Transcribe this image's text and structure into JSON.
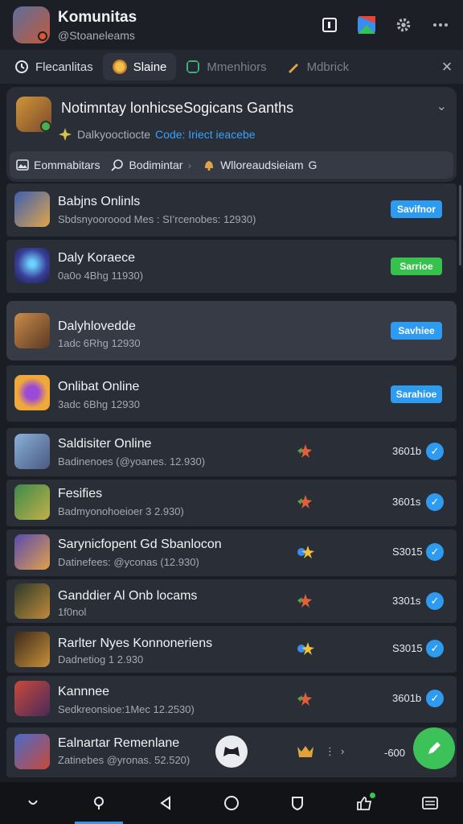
{
  "header": {
    "title": "Komunitas",
    "handle": "@Stoaneleams",
    "icons": [
      "square-icon",
      "color-tile-icon",
      "gear-icon",
      "more-icon"
    ]
  },
  "tabs": [
    {
      "label": "Flecanlitas",
      "icon": "clock-icon",
      "active": false
    },
    {
      "label": "Slaine",
      "icon": "game-icon",
      "active": true
    },
    {
      "label": "Mmenhiors",
      "icon": "chat-icon",
      "active": false
    },
    {
      "label": "Mdbrick",
      "icon": "pen-icon",
      "active": false
    }
  ],
  "notification": {
    "title": "Notimntay lonhicseSogicans Ganths",
    "sub_prefix": "Dalkyooctiocte",
    "sub_link": "Code: Iriect ieacebe",
    "filters": [
      {
        "label": "Eommabitars",
        "icon": "image-icon"
      },
      {
        "label": "Bodimintar",
        "icon": "search-icon"
      },
      {
        "label": "Wlloreaudsieiam",
        "icon": "bell-icon"
      }
    ],
    "filters_extra": "G"
  },
  "games": [
    {
      "title": "Babjns Onlinls",
      "subtitle": "Sbdsnyooroood Mes : SI’rcenobes: 12930)",
      "action": "Savifnor",
      "action_color": "blue"
    },
    {
      "title": "Daly Koraece",
      "subtitle": "0a0o 4Bhg 11930)",
      "action": "Sarrioe",
      "action_color": "green"
    },
    {
      "title": "Dalyhlovedde",
      "subtitle": "1adc 6Rhg 12930",
      "action": "Savhiee",
      "action_color": "blue"
    },
    {
      "title": "Onlibat Online",
      "subtitle": "3adc 6Bhg 12930",
      "action": "Sarahioe",
      "action_color": "blue"
    }
  ],
  "list": [
    {
      "title": "Saldisiter Online",
      "subtitle": "Badinenoes (@yoanes. 12.930)",
      "count": "3601b",
      "badge": "leaf-icon"
    },
    {
      "title": "Fesifies",
      "subtitle": "Badmyonohoeioer 3 2.930)",
      "count": "3601s",
      "badge": "leaf-icon"
    },
    {
      "title": "Sarynicfopent Gd Sbanlocon",
      "subtitle": "Datinefees: @yconas (12.930)",
      "count": "S3015",
      "badge": "gem-icon"
    },
    {
      "title": "Ganddier Al Onb locams",
      "subtitle": "1f0nol",
      "count": "3301s",
      "badge": "leaf-icon"
    },
    {
      "title": "Rarlter Nyes Konnoneriens",
      "subtitle": "Dadnetiog 1 2.930",
      "count": "S3015",
      "badge": "gem-icon"
    },
    {
      "title": "Kannnee",
      "subtitle": "Sedkreonsioe:1Mec 12.2530)",
      "count": "3601b",
      "badge": "leaf-icon"
    },
    {
      "title": "Ealnartar Remenlane",
      "subtitle": "Zatinebes @yronas. 52.520)",
      "count": "-600",
      "badge": "crown-icon"
    }
  ],
  "colors": {
    "accent": "#2e9bf0",
    "success": "#37c24d",
    "background": "#1a1d23",
    "card": "#2a2e37"
  }
}
